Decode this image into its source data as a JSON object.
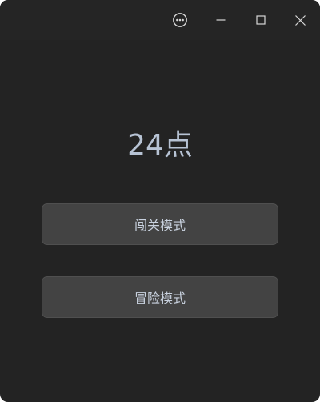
{
  "window": {
    "title_icons": [
      "more-options-icon",
      "minimize-icon",
      "maximize-icon",
      "close-icon"
    ]
  },
  "main": {
    "title": "24点",
    "buttons": {
      "level_mode": "闯关模式",
      "adventure_mode": "冒险模式"
    }
  },
  "colors": {
    "background": "#232323",
    "title_text": "#b7c3d4",
    "button_bg": "#434343",
    "button_text": "#c9d2df"
  }
}
